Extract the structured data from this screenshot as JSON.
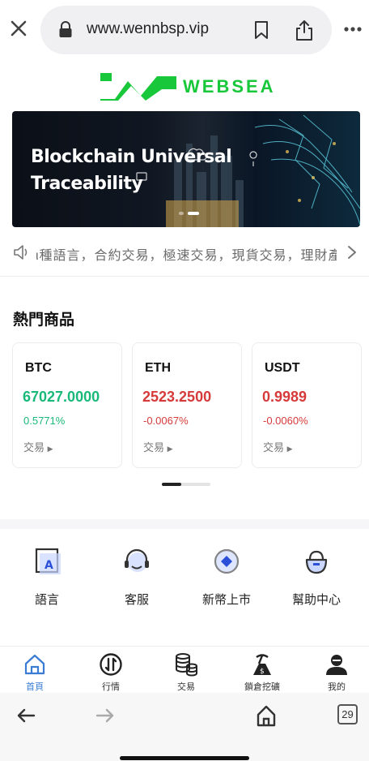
{
  "browser": {
    "url": "www.wennbsp.vip",
    "tab_count": "29"
  },
  "brand": {
    "name": "WEBSEA",
    "color": "#18c83a"
  },
  "banner": {
    "title_line1": "Blockchain Universal",
    "title_line2": "Traceability",
    "slide_count": 2,
    "active_slide": 2
  },
  "marquee": {
    "text": "ι種語言，合約交易，極速交易，現貨交易，理財產品"
  },
  "hot": {
    "title": "熱門商品",
    "cards": [
      {
        "symbol": "BTC",
        "price": "67027.0000",
        "change": "0.5771%",
        "trend": "up",
        "trade_label": "交易"
      },
      {
        "symbol": "ETH",
        "price": "2523.2500",
        "change": "-0.0067%",
        "trend": "down",
        "trade_label": "交易"
      },
      {
        "symbol": "USDT",
        "price": "0.9989",
        "change": "-0.0060%",
        "trend": "down",
        "trade_label": "交易"
      }
    ],
    "scroll_position": 0.4
  },
  "quick_menu": [
    {
      "label": "語言",
      "icon": "language-icon"
    },
    {
      "label": "客服",
      "icon": "headset-icon"
    },
    {
      "label": "新幣上市",
      "icon": "new-coin-icon"
    },
    {
      "label": "幫助中心",
      "icon": "help-center-icon"
    }
  ],
  "tabbar": [
    {
      "label": "首頁",
      "icon": "home-icon",
      "active": true
    },
    {
      "label": "行情",
      "icon": "market-icon",
      "active": false
    },
    {
      "label": "交易",
      "icon": "coins-stack-icon",
      "active": false
    },
    {
      "label": "鎖倉挖礦",
      "icon": "mining-icon",
      "active": false
    },
    {
      "label": "我的",
      "icon": "user-icon",
      "active": false
    }
  ],
  "colors": {
    "up": "#1ab97a",
    "down": "#d63a3a",
    "accent": "#3a7bd5"
  }
}
